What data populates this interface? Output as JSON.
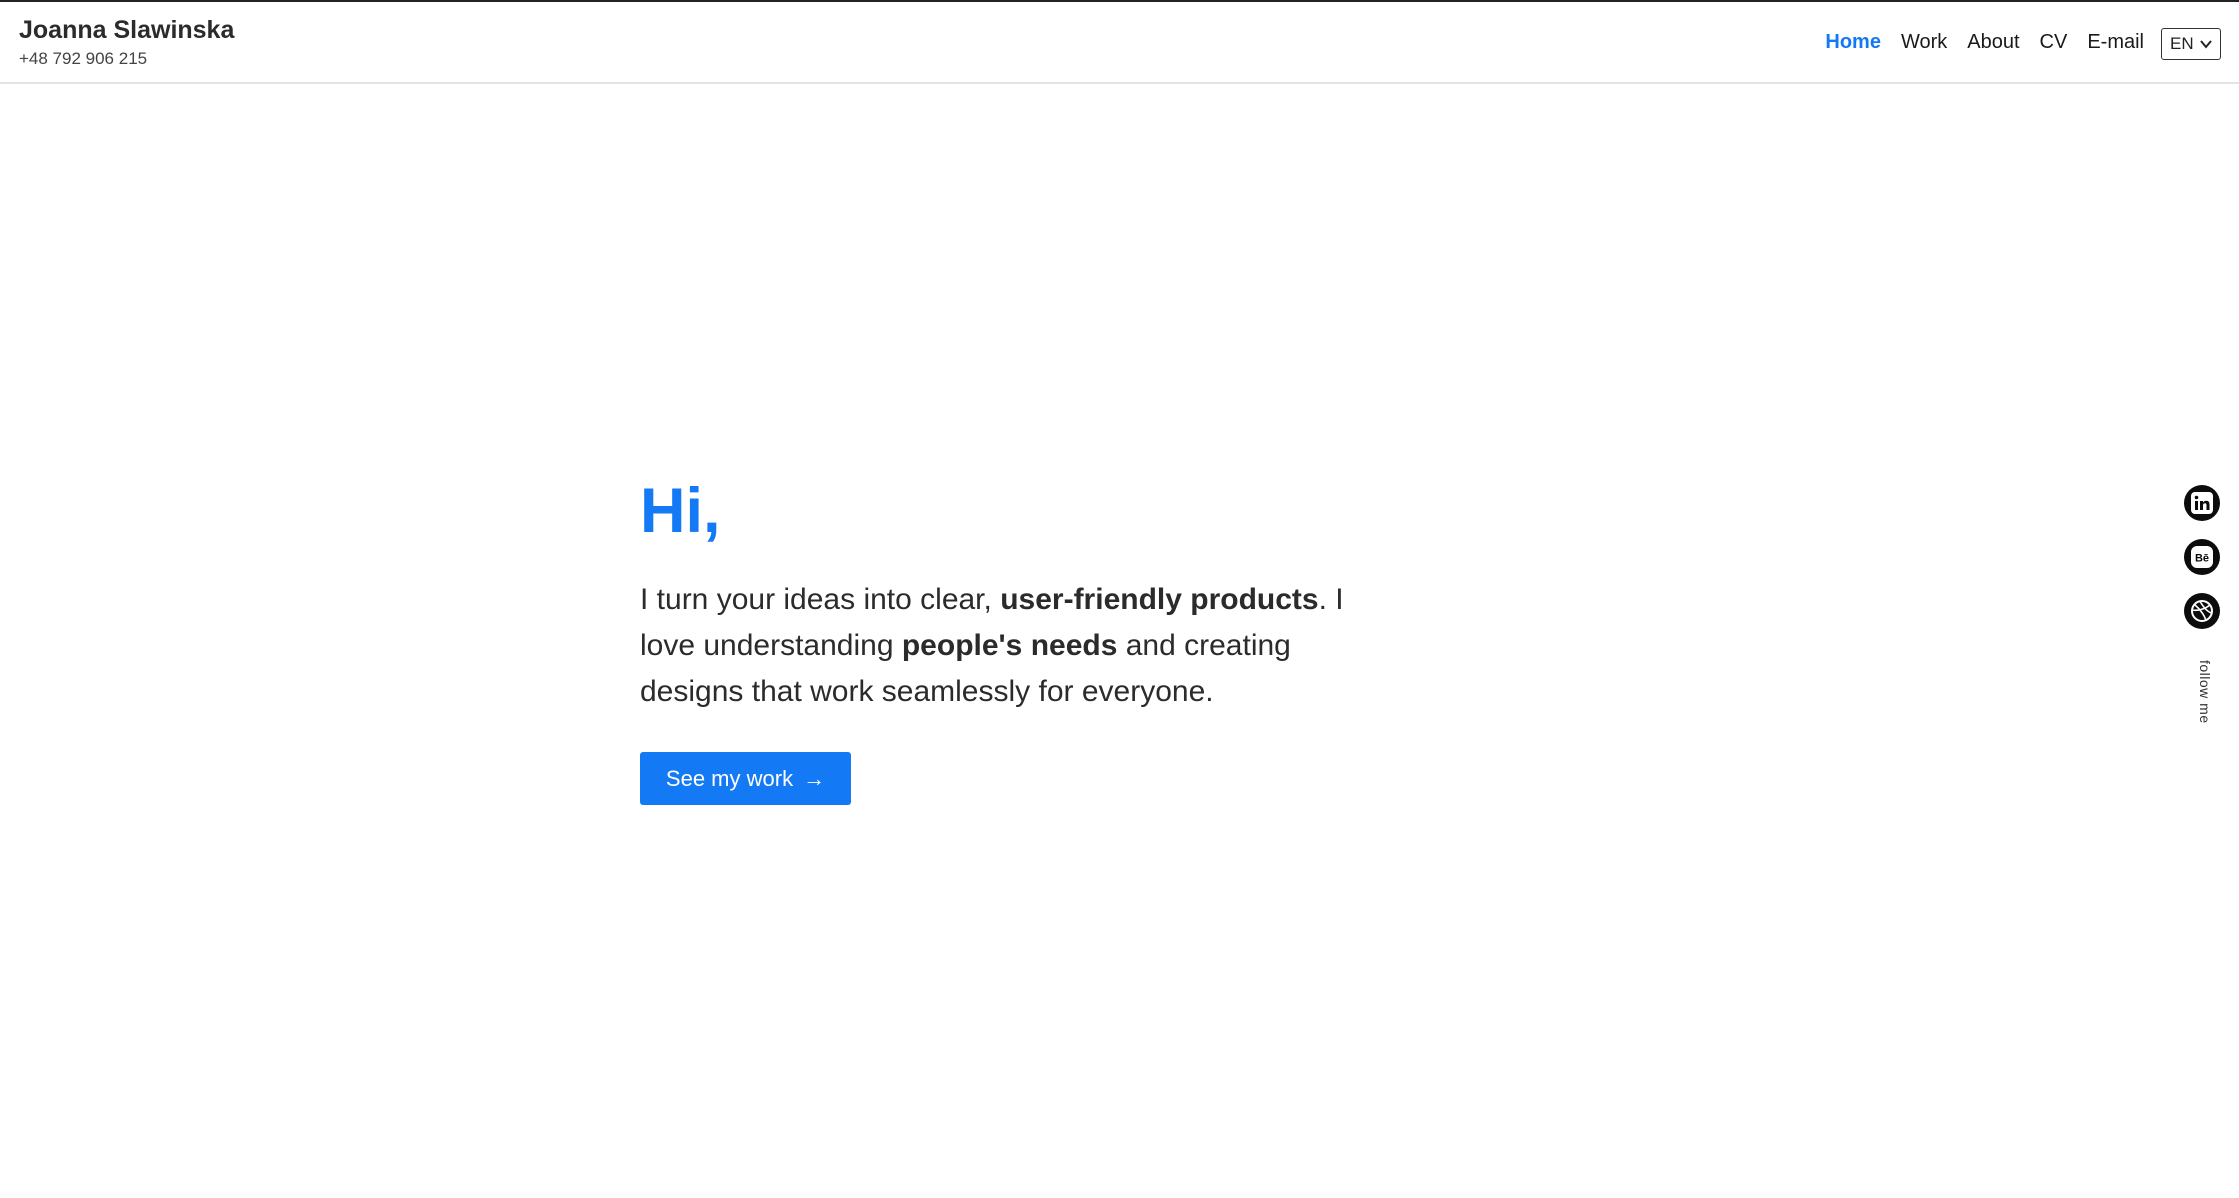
{
  "header": {
    "name": "Joanna Slawinska",
    "phone": "+48 792 906 215",
    "nav": [
      {
        "label": "Home",
        "active": true
      },
      {
        "label": "Work",
        "active": false
      },
      {
        "label": "About",
        "active": false
      },
      {
        "label": "CV",
        "active": false
      },
      {
        "label": "E-mail",
        "active": false
      }
    ],
    "language": "EN"
  },
  "hero": {
    "title": "Hi,",
    "text_part1": "I turn your ideas into clear, ",
    "text_bold1": "user-friendly products",
    "text_part2": ". I love understanding ",
    "text_bold2": "people's needs",
    "text_part3": " and creating designs that work seamlessly for everyone.",
    "cta_label": "See my work",
    "cta_arrow": "→"
  },
  "social": {
    "icons": [
      "linkedin-icon",
      "behance-icon",
      "dribbble-icon"
    ],
    "behance_glyph": "Bē",
    "follow_label": "follow me"
  },
  "colors": {
    "accent": "#1479f5",
    "text": "#2b2b2b",
    "social_bg": "#0c0c0c"
  }
}
